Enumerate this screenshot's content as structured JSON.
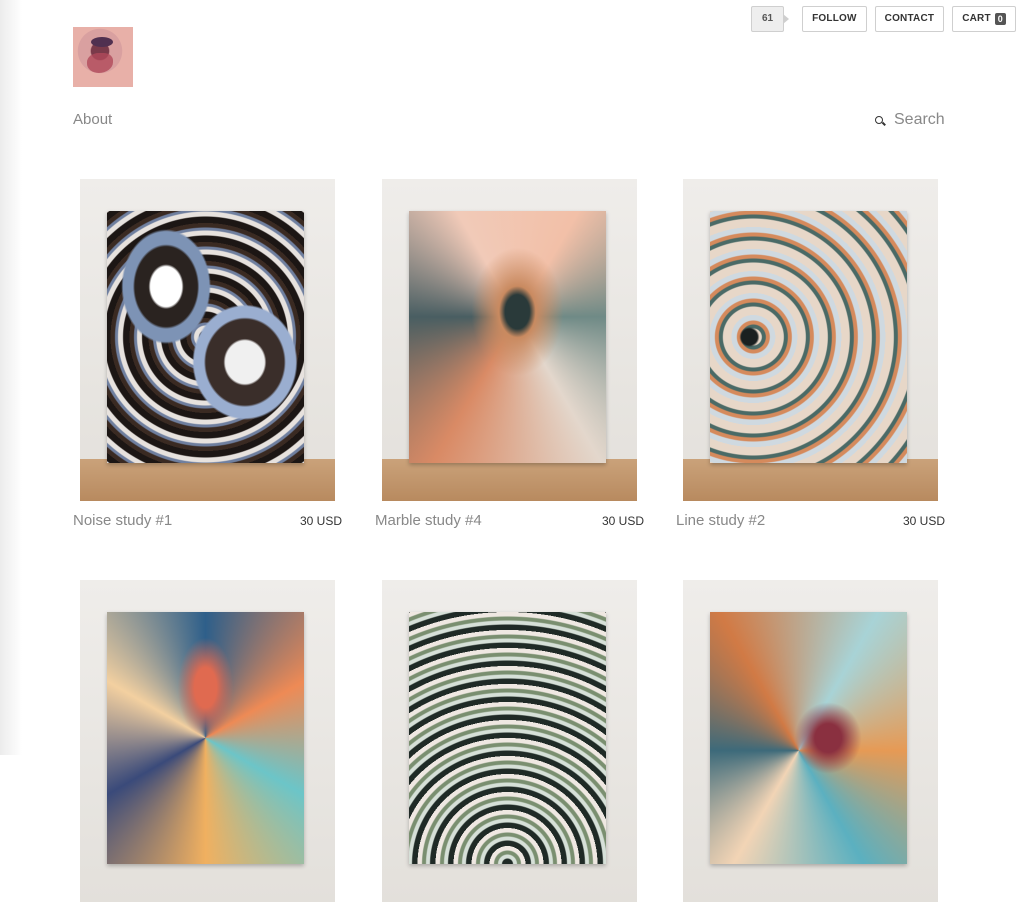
{
  "topbar": {
    "count": "61",
    "follow": "FOLLOW",
    "contact": "CONTACT",
    "cart": "CART",
    "cart_count": "0"
  },
  "nav": {
    "about": "About"
  },
  "search": {
    "placeholder": "Search"
  },
  "products": [
    {
      "title": "Noise study #1",
      "price": "30 USD"
    },
    {
      "title": "Marble study #4",
      "price": "30 USD"
    },
    {
      "title": "Line study #2",
      "price": "30 USD"
    },
    {
      "title": "",
      "price": ""
    },
    {
      "title": "",
      "price": ""
    },
    {
      "title": "",
      "price": ""
    }
  ]
}
